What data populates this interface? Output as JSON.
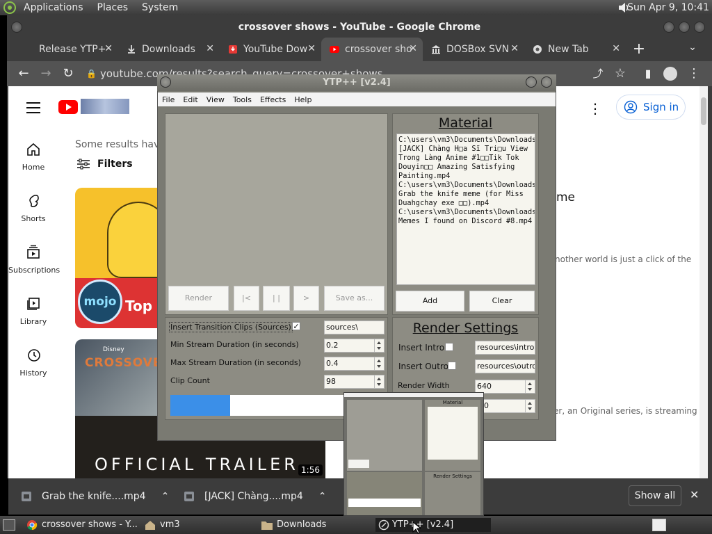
{
  "panel": {
    "menus": [
      "Applications",
      "Places",
      "System"
    ],
    "clock": "Sun Apr  9, 10:41"
  },
  "chrome": {
    "window_title": "crossover shows - YouTube - Google Chrome",
    "tabs": [
      {
        "label": "Release YTP+"
      },
      {
        "label": "Downloads"
      },
      {
        "label": "YouTube Dow"
      },
      {
        "label": "crossover sho"
      },
      {
        "label": "DOSBox SVN"
      },
      {
        "label": "New Tab"
      }
    ],
    "new_tab": "+",
    "url": "youtube.com/results?search_query=crossover+shows"
  },
  "youtube": {
    "sidebar": [
      {
        "label": "Home",
        "icon": "home-icon"
      },
      {
        "label": "Shorts",
        "icon": "shorts-icon"
      },
      {
        "label": "Subscriptions",
        "icon": "subscriptions-icon"
      },
      {
        "label": "Library",
        "icon": "library-icon"
      },
      {
        "label": "History",
        "icon": "history-icon"
      }
    ],
    "sign_in": "Sign in",
    "notice": "Some results have",
    "filters": "Filters",
    "result1": {
      "title_tail": "me",
      "desc_tail": "nother world is just a click of the",
      "thumb_brand": "mojo",
      "thumb_text": "Top"
    },
    "result2": {
      "desc_tail": "er, an Original series, is streaming",
      "thumb_brand": "Disney",
      "thumb_title": "CROSSOVER",
      "thumb_caption": "OFFICIAL TRAILER",
      "duration": "1:56"
    }
  },
  "shelf": {
    "items": [
      "Grab the knife....mp4",
      "[JACK] Chàng....mp4"
    ],
    "show_all": "Show all"
  },
  "taskbar": {
    "tasks": [
      "crossover shows - Y...",
      "vm3",
      "Downloads",
      "YTP++ [v2.4]"
    ]
  },
  "ytp": {
    "title": "YTP++ [v2.4]",
    "menus": [
      "File",
      "Edit",
      "View",
      "Tools",
      "Effects",
      "Help"
    ],
    "controls": {
      "render": "Render",
      "start": "|<",
      "pause": "| |",
      "play": ">",
      "save": "Save as..."
    },
    "material": {
      "heading": "Material",
      "lines": [
        "C:\\users\\vm3\\Documents\\Downloads\\",
        "[JACK] Chàng H□a Sĩ Tri□u View",
        "Trong Làng Anime #1□□Tik Tok",
        "Douyin□□ Amazing Satisfying",
        "Painting.mp4",
        "C:\\users\\vm3\\Documents\\Downloads\\",
        "Grab the knife meme (for Miss",
        "Duahgchay exe □□).mp4",
        "C:\\users\\vm3\\Documents\\Downloads\\",
        "Memes I found on Discord #8.mp4"
      ],
      "add": "Add",
      "clear": "Clear"
    },
    "settings": {
      "transition_label": "Insert Transition Clips (Sources)",
      "transition_checked": true,
      "transition_value": "sources\\",
      "min_label": "Min Stream Duration (in seconds)",
      "min_value": "0.2",
      "max_label": "Max Stream Duration (in seconds)",
      "max_value": "0.4",
      "count_label": "Clip Count",
      "count_value": "98",
      "progress": 0.28
    },
    "render": {
      "heading": "Render Settings",
      "intro_label": "Insert Intro",
      "intro_value": "resources\\intro.",
      "outro_label": "Insert Outro",
      "outro_value": "resources\\outro.",
      "width_label": "Render Width",
      "width_value": "640",
      "height_value_partial": "0"
    }
  },
  "preview": {
    "title": "Material",
    "render_heading": "Render Settings"
  },
  "colors": {
    "accent": "#3b8fe8",
    "yt_red": "#ff0000",
    "chrome_dark": "#3c3c3c"
  }
}
